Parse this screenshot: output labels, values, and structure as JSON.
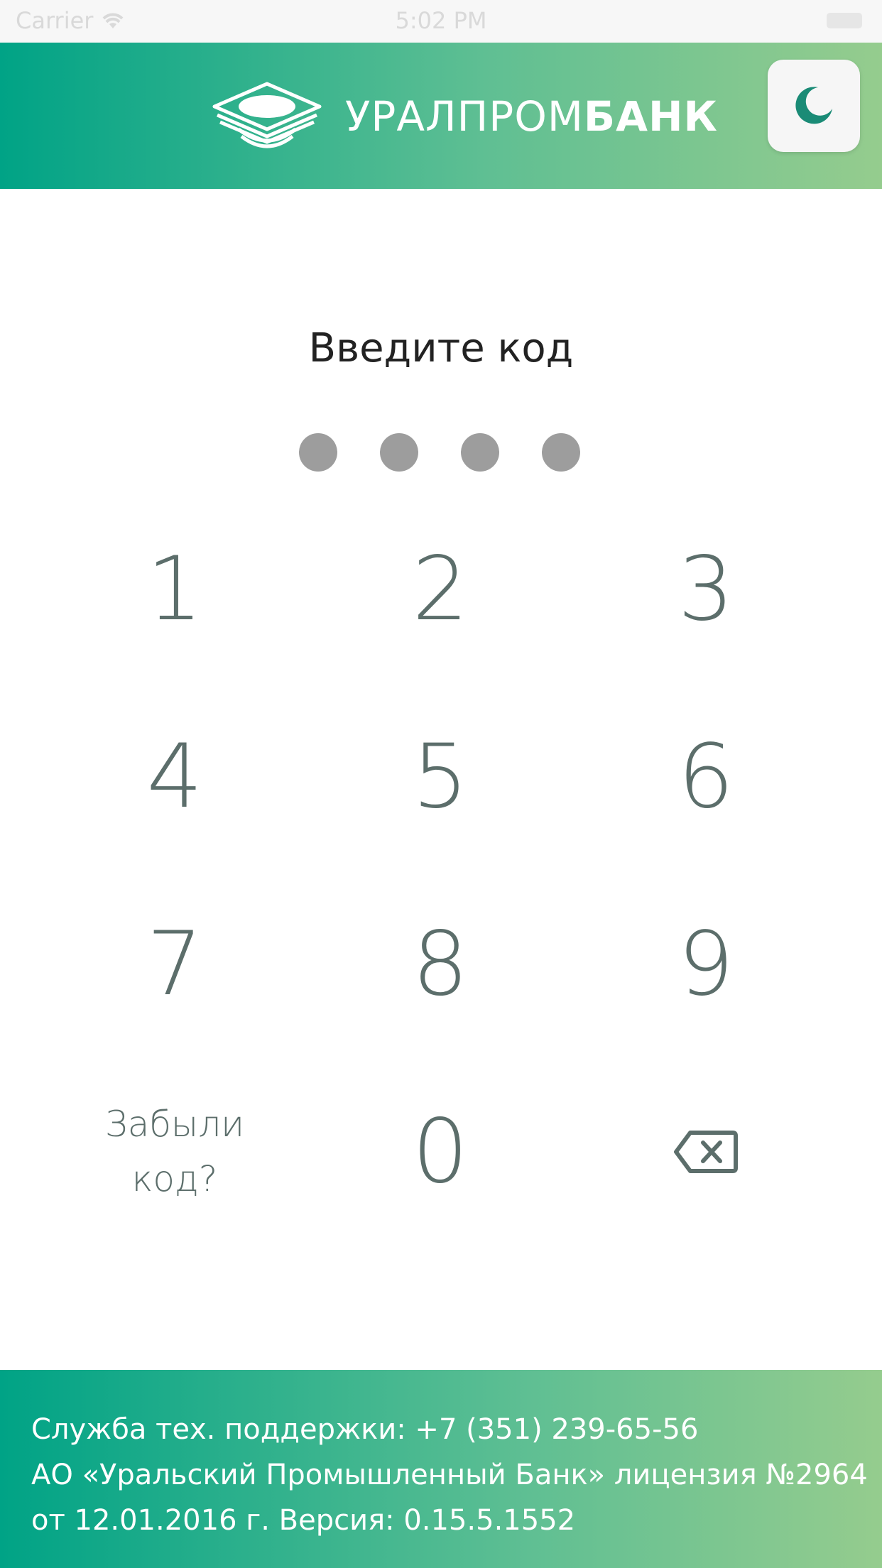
{
  "status_bar": {
    "carrier": "Carrier",
    "time": "5:02 PM"
  },
  "header": {
    "logo_text_regular": "УРАЛПРОМ",
    "logo_text_bold": "БАНК",
    "theme_icon": "moon-icon"
  },
  "pin": {
    "title": "Введите код",
    "length": 4,
    "dot_color": "#9d9d9d"
  },
  "keypad": {
    "k1": "1",
    "k2": "2",
    "k3": "3",
    "k4": "4",
    "k5": "5",
    "k6": "6",
    "k7": "7",
    "k8": "8",
    "k9": "9",
    "forgot_line1": "Забыли",
    "forgot_line2": "код?",
    "k0": "0",
    "backspace_icon": "backspace-icon"
  },
  "footer": {
    "line1": "Служба тех. поддержки: +7 (351) 239-65-56",
    "line2": "АО «Уральский Промышленный Банк» лицензия №2964",
    "line3": "от 12.01.2016 г. Версия: 0.15.5.1552"
  },
  "colors": {
    "brand_green": "#00a386",
    "brand_light_green": "#95cc8e",
    "key_text": "#5c6e6b"
  }
}
